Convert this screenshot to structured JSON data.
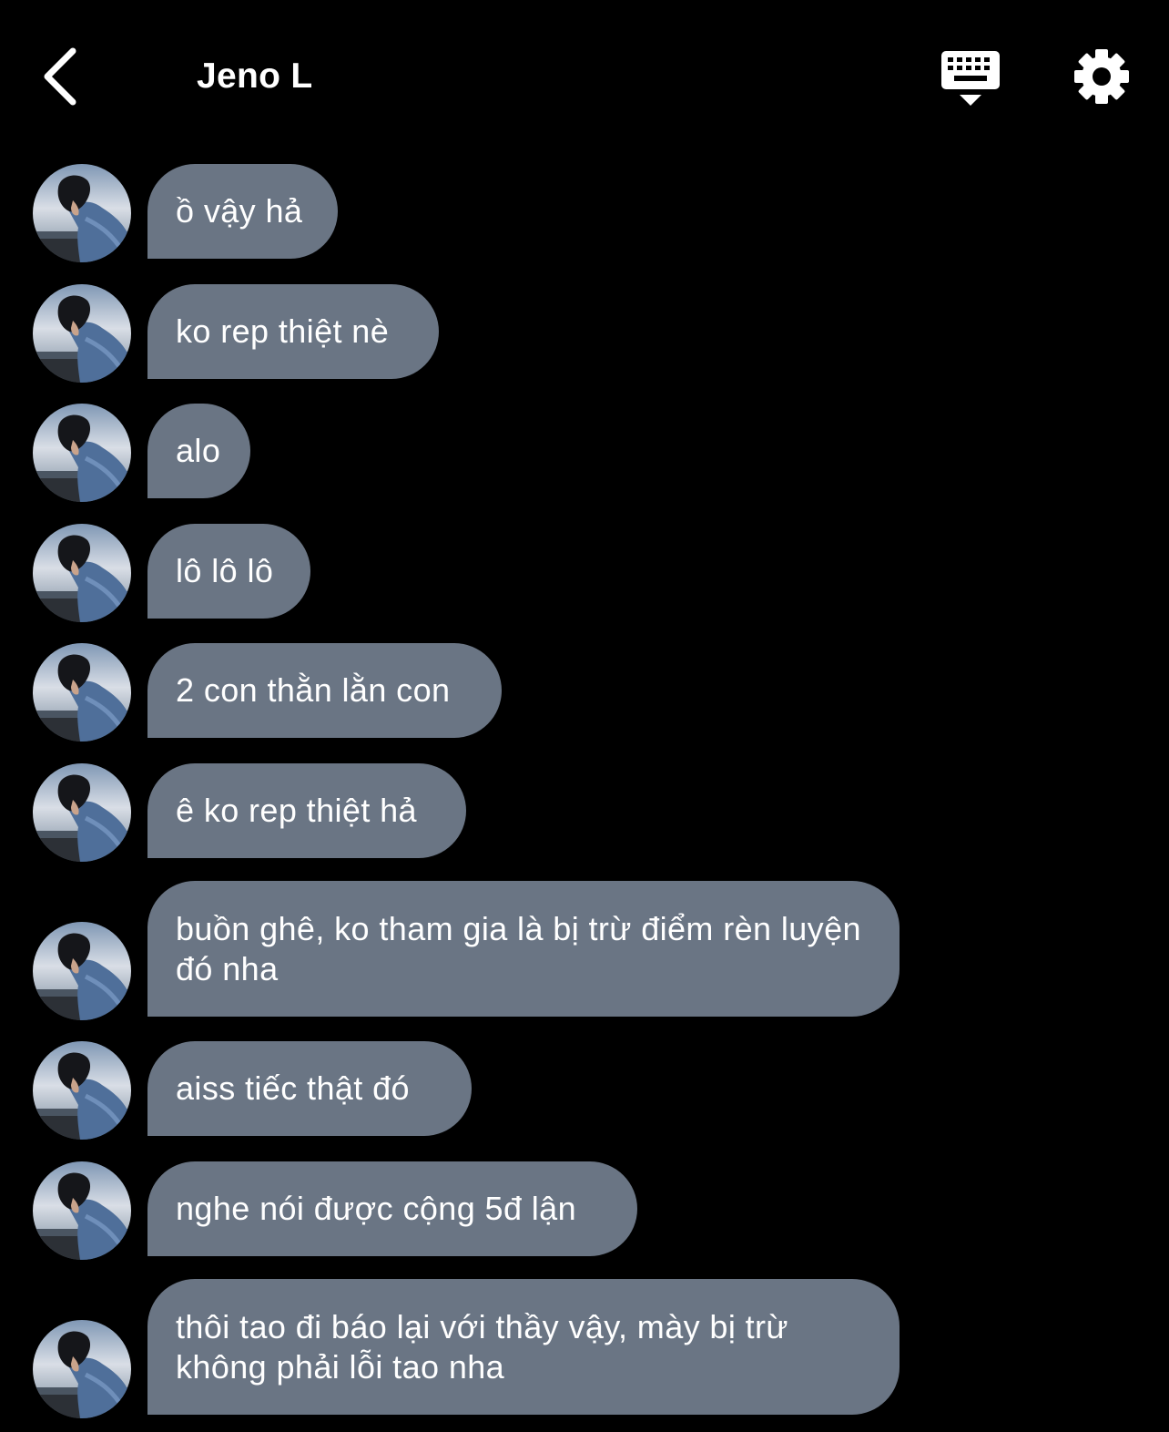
{
  "header": {
    "title": "Jeno L",
    "back_icon": "chevron-left-icon",
    "keyboard_icon": "keyboard-hide-icon",
    "settings_icon": "gear-icon"
  },
  "colors": {
    "background": "#000000",
    "bubble": "#6a7584",
    "text": "#ffffff"
  },
  "messages": [
    {
      "text": "ồ vậy hả"
    },
    {
      "text": "ko rep thiệt nè"
    },
    {
      "text": "alo"
    },
    {
      "text": "lô lô lô"
    },
    {
      "text": "2 con thằn lằn con"
    },
    {
      "text": "ê ko rep thiệt hả"
    },
    {
      "text": "buồn ghê, ko tham gia là bị trừ điểm rèn luyện đó nha"
    },
    {
      "text": "aiss tiếc thật đó"
    },
    {
      "text": "nghe nói được cộng 5đ lận"
    },
    {
      "text": "thôi tao đi báo lại với thầy vậy, mày bị trừ không phải lỗi tao nha"
    }
  ]
}
